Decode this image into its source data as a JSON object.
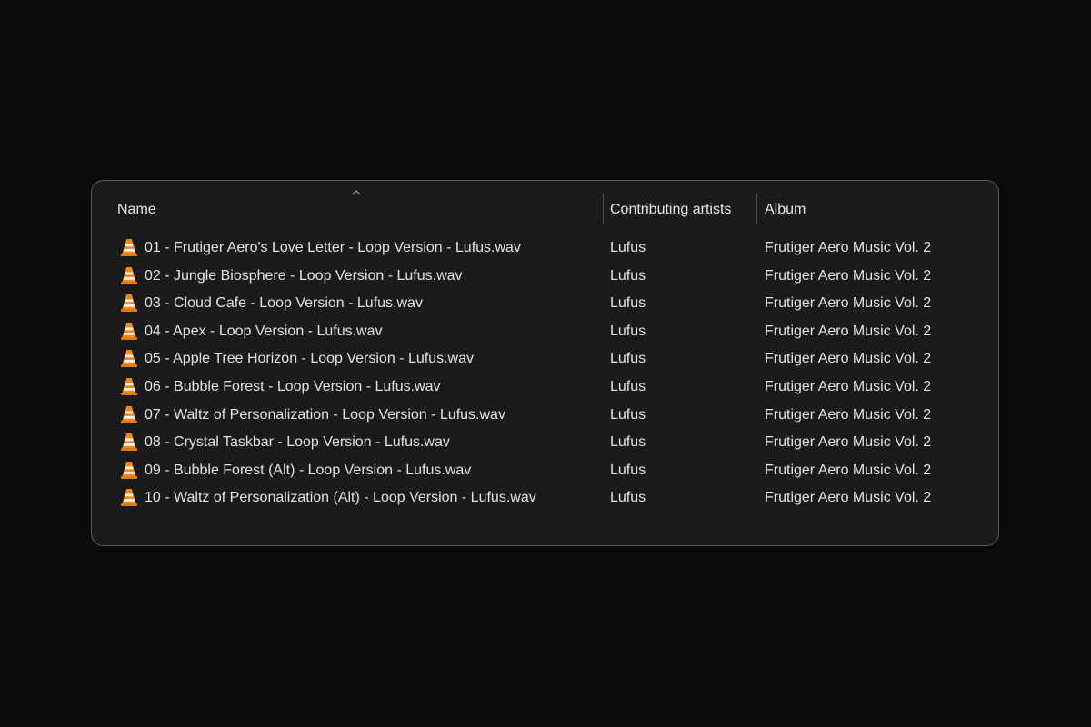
{
  "columns": {
    "name": "Name",
    "artist": "Contributing artists",
    "album": "Album"
  },
  "sort": {
    "column": "name",
    "direction": "ascending",
    "icon": "chevron-up-icon"
  },
  "file_icon": "vlc-cone-icon",
  "files": [
    {
      "name": "01 - Frutiger Aero's Love Letter - Loop Version - Lufus.wav",
      "artist": "Lufus",
      "album": "Frutiger Aero Music Vol. 2"
    },
    {
      "name": "02 - Jungle Biosphere - Loop Version - Lufus.wav",
      "artist": "Lufus",
      "album": "Frutiger Aero Music Vol. 2"
    },
    {
      "name": "03 - Cloud Cafe - Loop Version - Lufus.wav",
      "artist": "Lufus",
      "album": "Frutiger Aero Music Vol. 2"
    },
    {
      "name": "04 - Apex - Loop Version - Lufus.wav",
      "artist": "Lufus",
      "album": "Frutiger Aero Music Vol. 2"
    },
    {
      "name": "05 - Apple Tree Horizon - Loop Version - Lufus.wav",
      "artist": "Lufus",
      "album": "Frutiger Aero Music Vol. 2"
    },
    {
      "name": "06 - Bubble Forest - Loop Version - Lufus.wav",
      "artist": "Lufus",
      "album": "Frutiger Aero Music Vol. 2"
    },
    {
      "name": "07 - Waltz of Personalization - Loop Version - Lufus.wav",
      "artist": "Lufus",
      "album": "Frutiger Aero Music Vol. 2"
    },
    {
      "name": "08 - Crystal Taskbar - Loop Version - Lufus.wav",
      "artist": "Lufus",
      "album": "Frutiger Aero Music Vol. 2"
    },
    {
      "name": "09 - Bubble Forest (Alt) - Loop Version - Lufus.wav",
      "artist": "Lufus",
      "album": "Frutiger Aero Music Vol. 2"
    },
    {
      "name": "10 - Waltz of Personalization (Alt) - Loop Version - Lufus.wav",
      "artist": "Lufus",
      "album": "Frutiger Aero Music Vol. 2"
    }
  ],
  "colors": {
    "background": "#0b0b0b",
    "panel": "#1b1b1b",
    "text": "#e2e2e2",
    "icon_orange": "#f08a1c"
  }
}
